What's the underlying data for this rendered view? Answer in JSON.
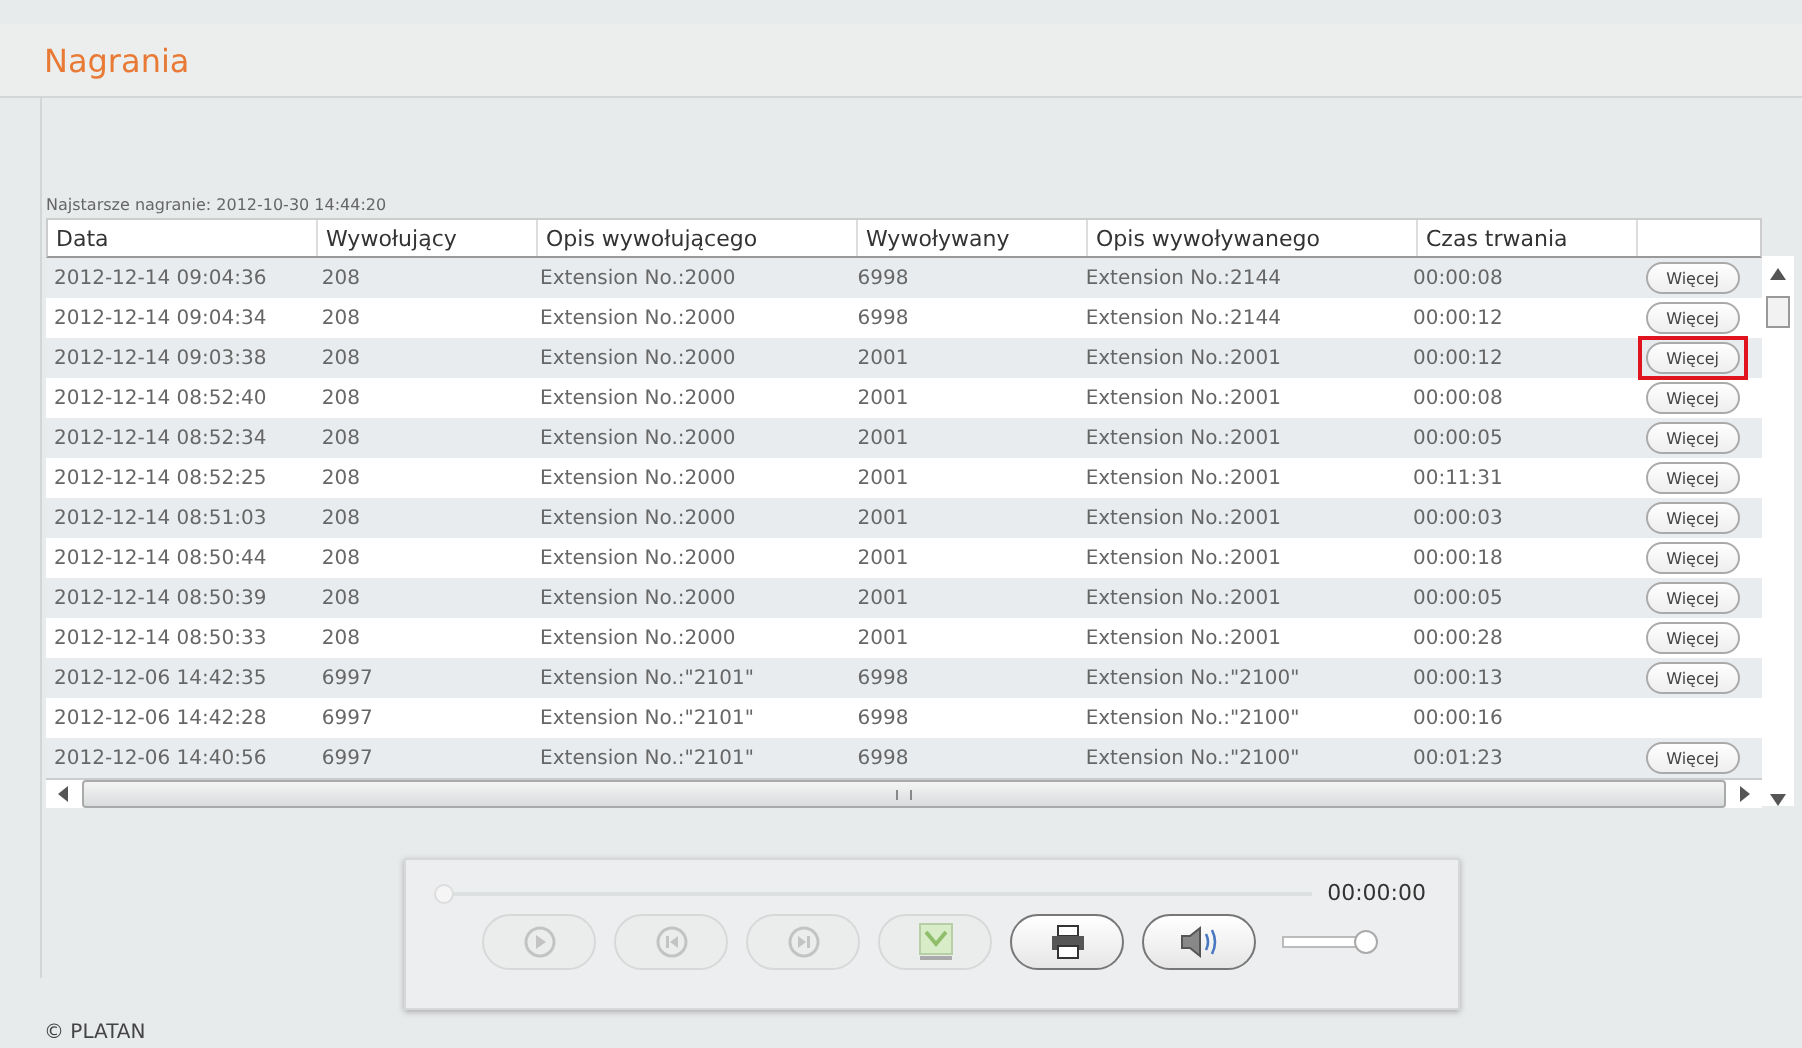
{
  "page_title": "Nagrania",
  "oldest": "Najstarsze nagranie: 2012-10-30 14:44:20",
  "table": {
    "columns": [
      "Data",
      "Wywołujący",
      "Opis wywołującego",
      "Wywoływany",
      "Opis wywoływanego",
      "Czas trwania"
    ],
    "rows": [
      {
        "cells": [
          "2012-12-14 09:04:36",
          "208",
          "Extension No.:2000",
          "6998",
          "Extension No.:2144",
          "00:00:08"
        ],
        "more": "Więcej",
        "highlighted": false
      },
      {
        "cells": [
          "2012-12-14 09:04:34",
          "208",
          "Extension No.:2000",
          "6998",
          "Extension No.:2144",
          "00:00:12"
        ],
        "more": "Więcej",
        "highlighted": false
      },
      {
        "cells": [
          "2012-12-14 09:03:38",
          "208",
          "Extension No.:2000",
          "2001",
          "Extension No.:2001",
          "00:00:12"
        ],
        "more": "Więcej",
        "highlighted": true
      },
      {
        "cells": [
          "2012-12-14 08:52:40",
          "208",
          "Extension No.:2000",
          "2001",
          "Extension No.:2001",
          "00:00:08"
        ],
        "more": "Więcej",
        "highlighted": false
      },
      {
        "cells": [
          "2012-12-14 08:52:34",
          "208",
          "Extension No.:2000",
          "2001",
          "Extension No.:2001",
          "00:00:05"
        ],
        "more": "Więcej",
        "highlighted": false
      },
      {
        "cells": [
          "2012-12-14 08:52:25",
          "208",
          "Extension No.:2000",
          "2001",
          "Extension No.:2001",
          "00:11:31"
        ],
        "more": "Więcej",
        "highlighted": false
      },
      {
        "cells": [
          "2012-12-14 08:51:03",
          "208",
          "Extension No.:2000",
          "2001",
          "Extension No.:2001",
          "00:00:03"
        ],
        "more": "Więcej",
        "highlighted": false
      },
      {
        "cells": [
          "2012-12-14 08:50:44",
          "208",
          "Extension No.:2000",
          "2001",
          "Extension No.:2001",
          "00:00:18"
        ],
        "more": "Więcej",
        "highlighted": false
      },
      {
        "cells": [
          "2012-12-14 08:50:39",
          "208",
          "Extension No.:2000",
          "2001",
          "Extension No.:2001",
          "00:00:05"
        ],
        "more": "Więcej",
        "highlighted": false
      },
      {
        "cells": [
          "2012-12-14 08:50:33",
          "208",
          "Extension No.:2000",
          "2001",
          "Extension No.:2001",
          "00:00:28"
        ],
        "more": "Więcej",
        "highlighted": false
      },
      {
        "cells": [
          "2012-12-06 14:42:35",
          "6997",
          "Extension No.:\"2101\"",
          "6998",
          "Extension No.:\"2100\"",
          "00:00:13"
        ],
        "more": "Więcej",
        "highlighted": false
      },
      {
        "cells": [
          "2012-12-06 14:42:28",
          "6997",
          "Extension No.:\"2101\"",
          "6998",
          "Extension No.:\"2100\"",
          "00:00:16"
        ]
      },
      {
        "cells": [
          "2012-12-06 14:40:56",
          "6997",
          "Extension No.:\"2101\"",
          "6998",
          "Extension No.:\"2100\"",
          "00:01:23"
        ],
        "more": "Więcej",
        "highlighted": false
      }
    ]
  },
  "player": {
    "progress": {
      "level": 0
    },
    "time": "00:00:00",
    "buttons": [
      {
        "kind": "play",
        "disabled": true
      },
      {
        "kind": "previous",
        "disabled": true
      },
      {
        "kind": "next",
        "disabled": true
      },
      {
        "kind": "download",
        "disabled": true
      },
      {
        "kind": "print",
        "disabled": false
      },
      {
        "kind": "volume",
        "disabled": false
      }
    ],
    "volume": {
      "level": 1
    }
  },
  "footer": "© PLATAN"
}
